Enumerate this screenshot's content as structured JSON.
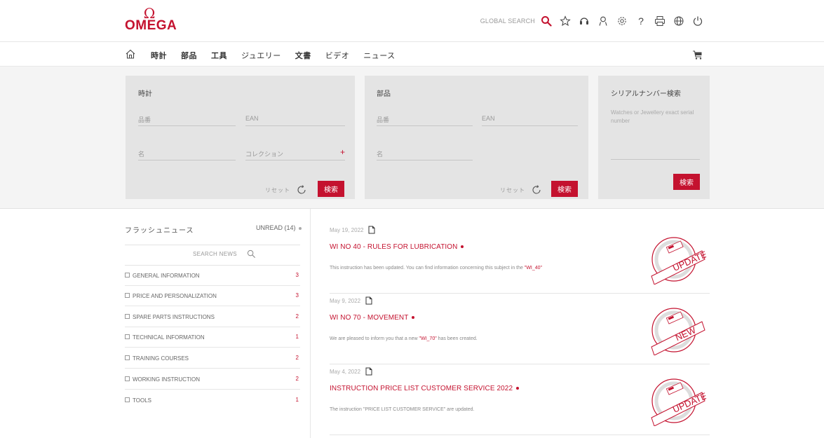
{
  "header": {
    "logo_symbol": "Ω",
    "logo_text": "OMEGA",
    "global_search_label": "GLOBAL SEARCH",
    "icons": [
      "search-icon",
      "star-icon",
      "support-icon",
      "user-icon",
      "gear-icon",
      "help-icon",
      "print-icon",
      "globe-icon",
      "power-icon"
    ],
    "help_glyph": "?"
  },
  "nav": {
    "items": [
      {
        "label": "時計",
        "bold": true
      },
      {
        "label": "部品",
        "bold": true
      },
      {
        "label": "工具",
        "bold": true
      },
      {
        "label": "ジュエリー",
        "bold": false
      },
      {
        "label": "文書",
        "bold": true
      },
      {
        "label": "ビデオ",
        "bold": false
      },
      {
        "label": "ニュース",
        "bold": false
      }
    ]
  },
  "watches_panel": {
    "title": "時計",
    "ref_placeholder": "品番",
    "ean_placeholder": "EAN",
    "name_placeholder": "名",
    "collection_placeholder": "コレクション",
    "collection_add": "+",
    "reset_label": "リセット",
    "search_button": "検索"
  },
  "parts_panel": {
    "title": "部品",
    "ref_placeholder": "品番",
    "ean_placeholder": "EAN",
    "name_placeholder": "名",
    "reset_label": "リセット",
    "search_button": "検索"
  },
  "serial_panel": {
    "title": "シリアルナンバー検索",
    "description": "Watches or Jewellery exact serial number",
    "search_button": "検索"
  },
  "flash_news": {
    "title": "フラッシュニュース",
    "unread": "UNREAD (14)",
    "search_placeholder": "SEARCH NEWS",
    "categories": [
      {
        "label": "GENERAL INFORMATION",
        "count": "3"
      },
      {
        "label": "PRICE AND PERSONALIZATION",
        "count": "3"
      },
      {
        "label": "SPARE PARTS INSTRUCTIONS",
        "count": "2"
      },
      {
        "label": "TECHNICAL INFORMATION",
        "count": "1"
      },
      {
        "label": "TRAINING COURSES",
        "count": "2"
      },
      {
        "label": "WORKING INSTRUCTION",
        "count": "2"
      },
      {
        "label": "TOOLS",
        "count": "1"
      }
    ]
  },
  "news": [
    {
      "date": "May 19, 2022",
      "title": "WI NO 40 - RULES FOR LUBRICATION",
      "text_before": "This instruction has been updated. You can find information concerning this subject in the ",
      "link": "\"WI_40\"",
      "text_after": "",
      "stamp": "UPDATE"
    },
    {
      "date": "May 9, 2022",
      "title": "WI NO 70 - MOVEMENT",
      "text_before": "We are pleased to inform you that a new ",
      "link": "\"WI_70\"",
      "text_after": " has been created.",
      "stamp": "NEW"
    },
    {
      "date": "May 4, 2022",
      "title": "INSTRUCTION PRICE LIST CUSTOMER SERVICE 2022",
      "text_before": "The instruction \"PRICE LIST CUSTOMER SERVICE\" are updated.",
      "link": "",
      "text_after": "",
      "stamp": "UPDATE"
    }
  ],
  "colors": {
    "brand_red": "#c4122f",
    "panel_grey": "#e4e4e4",
    "band_grey": "#f4f4f4"
  }
}
